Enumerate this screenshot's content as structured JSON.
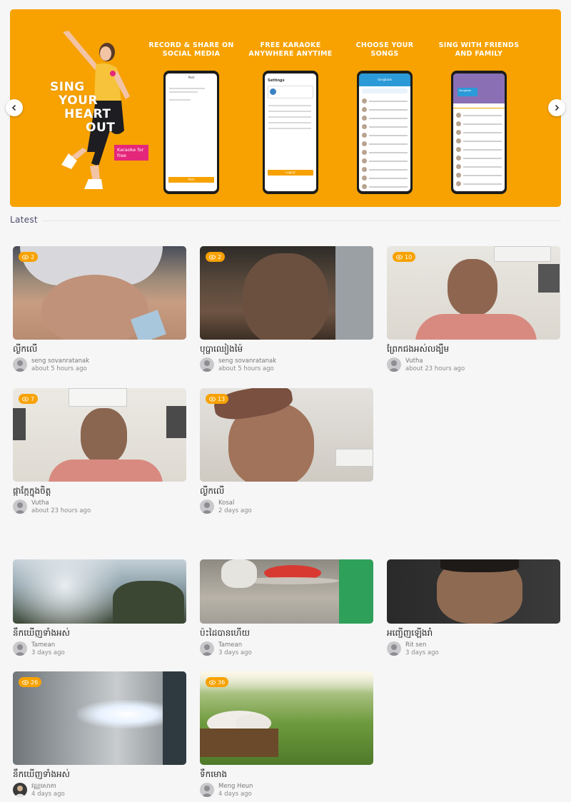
{
  "banner": {
    "hero_lines": [
      "SING",
      "YOUR",
      "HEART",
      "OUT"
    ],
    "hero_badge": "Karaoke for free",
    "features": [
      {
        "title": "RECORD & SHARE ON SOCIAL MEDIA",
        "screen_title": "Post",
        "button": "Post"
      },
      {
        "title": "FREE KARAOKE ANYWHERE ANYTIME",
        "screen_title": "Settings",
        "button": "Logout"
      },
      {
        "title": "CHOOSE YOUR SONGS",
        "screen_title": "Songbook"
      },
      {
        "title": "SING WITH FRIENDS AND FAMILY",
        "screen_title": "Songbook"
      }
    ],
    "accent_color": "#f7a200"
  },
  "section": {
    "title": "Latest"
  },
  "videos": [
    {
      "title": "ល្ងីកលើ",
      "author": "seng sovanratanak",
      "time": "about 5 hours ago",
      "views": "2"
    },
    {
      "title": "បុប្ផាឈៀងម៉ៃ",
      "author": "seng sovanratanak",
      "time": "about 5 hours ago",
      "views": "2"
    },
    {
      "title": "ព្រែកជងអស់លង្បឺម",
      "author": "Vutha",
      "time": "about 23 hours ago",
      "views": "10"
    },
    {
      "title": "ផ្កាកែ្កក្នុងចិត្ត",
      "author": "Vutha",
      "time": "about 23 hours ago",
      "views": "7"
    },
    {
      "title": "ល្ងីកលើ",
      "author": "Kosal",
      "time": "2 days ago",
      "views": "13"
    },
    {
      "title": "នឹកឃើញទាំងអស់",
      "author": "Tamean",
      "time": "3 days ago"
    },
    {
      "title": "ប៉ះដៃបានហើយ",
      "author": "Tamean",
      "time": "3 days ago"
    },
    {
      "title": "អញ្ជើញឡើងរាំ",
      "author": "Rit sen",
      "time": "3 days ago"
    },
    {
      "title": "នឹកឃើញទាំងអស់",
      "author": "វណ្ណសោភា",
      "time": "4 days ago",
      "views": "26"
    },
    {
      "title": "ទឹកមោង",
      "author": "Meng Heun",
      "time": "4 days ago",
      "views": "36"
    }
  ]
}
